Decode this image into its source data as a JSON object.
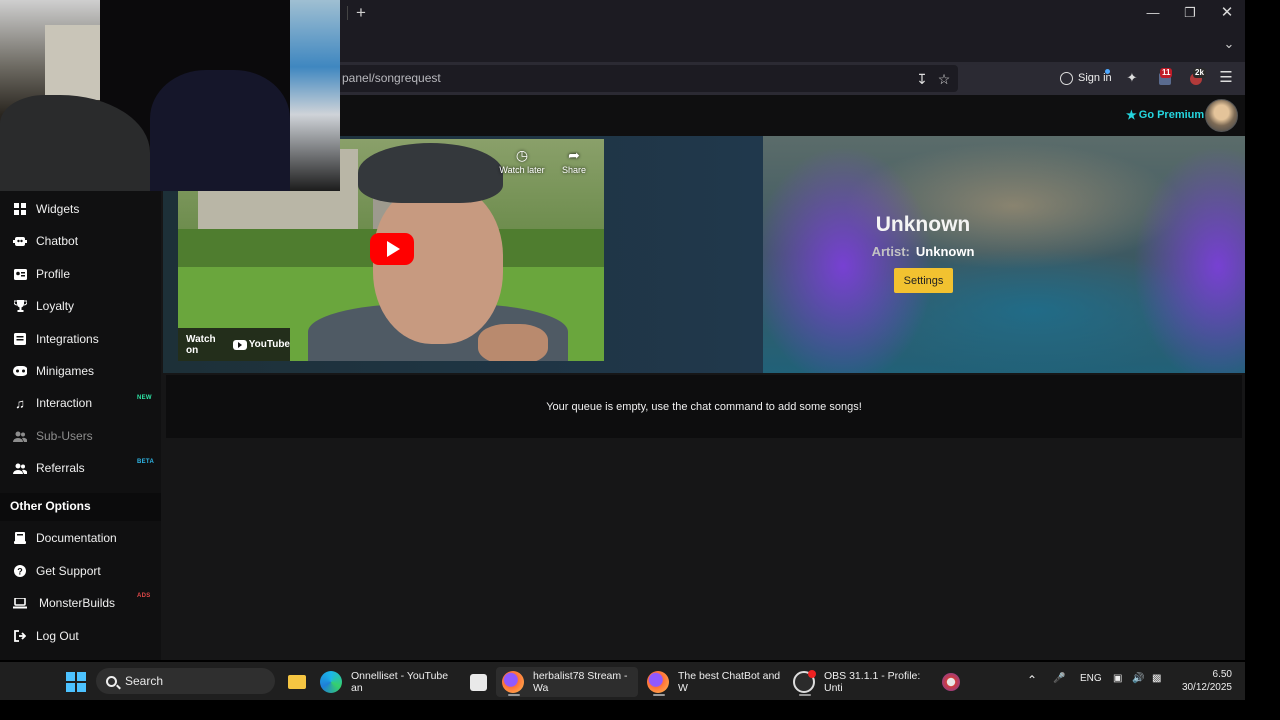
{
  "browser": {
    "url": "panel/songrequest",
    "new_tab": "+",
    "sign_in": "Sign in",
    "ext_badge_1": "11",
    "ext_badge_2": "2k",
    "window_controls": [
      "minimize",
      "restore",
      "close"
    ]
  },
  "header": {
    "go_premium": "Go Premium"
  },
  "sidebar": {
    "items": [
      {
        "label": "Widgets",
        "icon": "widgets-icon"
      },
      {
        "label": "Chatbot",
        "icon": "robot-icon"
      },
      {
        "label": "Profile",
        "icon": "profile-card-icon"
      },
      {
        "label": "Loyalty",
        "icon": "trophy-icon"
      },
      {
        "label": "Integrations",
        "icon": "integrations-icon"
      },
      {
        "label": "Minigames",
        "icon": "gamepad-icon"
      },
      {
        "label": "Interaction",
        "icon": "music-note-icon",
        "badge": "NEW"
      },
      {
        "label": "Sub-Users",
        "icon": "users-icon",
        "disabled": true
      },
      {
        "label": "Referrals",
        "icon": "referrals-icon",
        "badge": "BETA"
      }
    ],
    "other_title": "Other Options",
    "other": [
      {
        "label": "Documentation",
        "icon": "book-icon"
      },
      {
        "label": "Get Support",
        "icon": "help-icon"
      },
      {
        "label": "MonsterBuilds",
        "icon": "laptop-icon",
        "badge": "ADS"
      },
      {
        "label": "Log Out",
        "icon": "logout-icon"
      }
    ],
    "badge_colors": {
      "NEW": "#2ee6a6",
      "BETA": "#2fb7e8",
      "ADS": "#e04848"
    }
  },
  "player": {
    "song_title": "Unknown",
    "artist_label": "Artist:",
    "artist_value": "Unknown",
    "settings": "Settings",
    "video": {
      "watch_later": "Watch later",
      "share": "Share",
      "watch_on": "Watch on",
      "youtube": "YouTube"
    }
  },
  "queue": {
    "empty_message": "Your queue is empty, use the chat command to add some songs!"
  },
  "taskbar": {
    "search": "Search",
    "tasks": [
      {
        "label": "Onnelliset - YouTube an",
        "icon": "edge-icon"
      },
      {
        "label": "herbalist78 Stream - Wa",
        "icon": "firefox-icon"
      },
      {
        "label": "The best ChatBot and W",
        "icon": "firefox-icon"
      },
      {
        "label": "OBS 31.1.1 - Profile: Unti",
        "icon": "obs-icon"
      }
    ],
    "language": "ENG",
    "time": "6.50",
    "date": "30/12/2025"
  },
  "colors": {
    "accent": "#25d6df",
    "settings_button": "#f2c230",
    "youtube_red": "#ff0000"
  }
}
